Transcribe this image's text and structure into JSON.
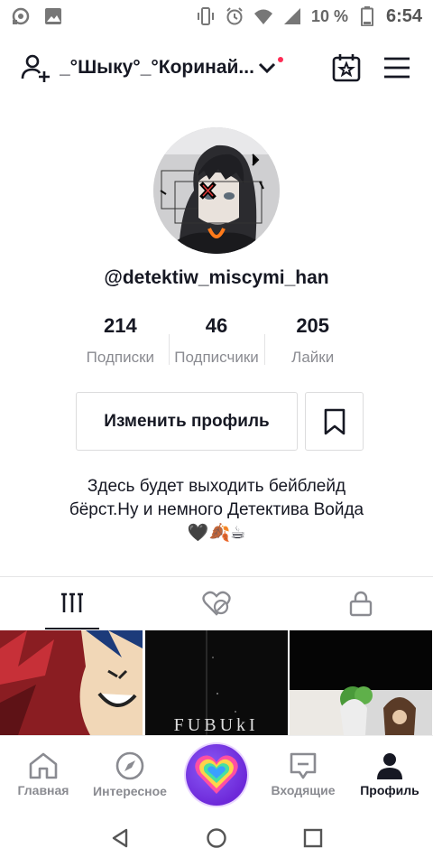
{
  "status_bar": {
    "battery_percent": "10 %",
    "time": "6:54"
  },
  "header": {
    "title": "_°Шыку°_°Коринай..."
  },
  "profile": {
    "username": "@detektiw_miscymi_han",
    "stats": [
      {
        "value": "214",
        "label": "Подписки"
      },
      {
        "value": "46",
        "label": "Подписчики"
      },
      {
        "value": "205",
        "label": "Лайки"
      }
    ],
    "edit_button": "Изменить профиль",
    "bio_line1": "Здесь будет выходить бейблейд",
    "bio_line2": "бёрст.Ну и немного Детектива Войда",
    "bio_line3": "🖤🍂☕"
  },
  "grid": {
    "item2_text": "FUBUkI"
  },
  "bottom_nav": {
    "home": "Главная",
    "discover": "Интересное",
    "inbox": "Входящие",
    "profile": "Профиль"
  },
  "colors": {
    "accent": "#fe2c55",
    "text": "#161823",
    "muted": "#8a8b91"
  }
}
